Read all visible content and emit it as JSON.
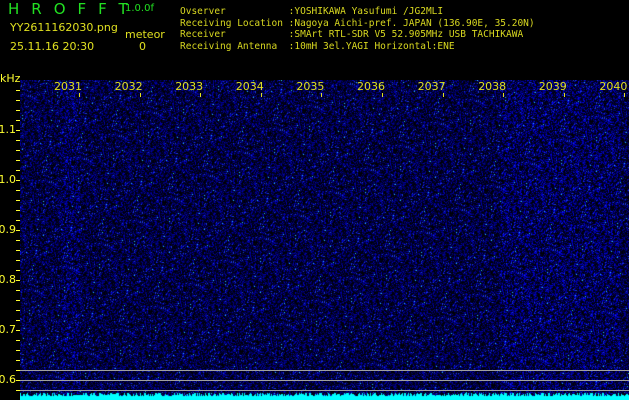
{
  "header": {
    "logo": "HROFFT",
    "version": "1.0.0f",
    "filename": "YY2611162030.png",
    "datetime": "25.11.16 20:30",
    "meteor_label": "meteor",
    "meteor_count": "0"
  },
  "info": [
    "Ovserver           :YOSHIKAWA Yasufumi /JG2MLI",
    "Receiving Location :Nagoya Aichi-pref. JAPAN (136.90E, 35.20N)",
    "Receiver           :SMArt RTL-SDR V5 52.905MHz USB TACHIKAWA",
    "Receiving Antenna  :10mH 3el.YAGI Horizontal:ENE"
  ],
  "axis": {
    "unit": "kHz",
    "y_labels": [
      "1.1",
      "1.0",
      "0.9",
      "0.8",
      "0.7",
      "0.6"
    ],
    "x_labels": [
      "2031",
      "2032",
      "2033",
      "2034",
      "2035",
      "2036",
      "2037",
      "2038",
      "2039",
      "2040"
    ]
  },
  "colors": {
    "background": "#000000",
    "noise": "#1010c0",
    "signal": "#00ffff",
    "text": "#e0e020"
  }
}
